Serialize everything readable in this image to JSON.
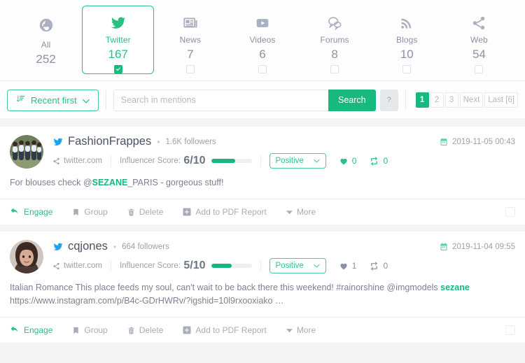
{
  "colors": {
    "accent": "#27c281",
    "accent_solid": "#18b97e",
    "muted": "#9aa1ad",
    "twitter_blue": "#1da1f2"
  },
  "tabs": [
    {
      "label": "All",
      "count": "252",
      "icon": "globe-icon",
      "active": false,
      "has_checkbox": false,
      "checked": false
    },
    {
      "label": "Twitter",
      "count": "167",
      "icon": "twitter-icon",
      "active": true,
      "has_checkbox": true,
      "checked": true
    },
    {
      "label": "News",
      "count": "7",
      "icon": "newspaper-icon",
      "active": false,
      "has_checkbox": true,
      "checked": false
    },
    {
      "label": "Videos",
      "count": "6",
      "icon": "video-icon",
      "active": false,
      "has_checkbox": true,
      "checked": false
    },
    {
      "label": "Forums",
      "count": "8",
      "icon": "forum-icon",
      "active": false,
      "has_checkbox": true,
      "checked": false
    },
    {
      "label": "Blogs",
      "count": "10",
      "icon": "rss-icon",
      "active": false,
      "has_checkbox": true,
      "checked": false
    },
    {
      "label": "Web",
      "count": "54",
      "icon": "share-icon",
      "active": false,
      "has_checkbox": true,
      "checked": false
    }
  ],
  "toolbar": {
    "sort_label": "Recent first",
    "search_placeholder": "Search in mentions",
    "search_value": "",
    "search_button": "Search",
    "help_button": "?",
    "pagination": [
      {
        "label": "1",
        "active": true
      },
      {
        "label": "2",
        "active": false
      },
      {
        "label": "3",
        "active": false
      },
      {
        "label": "Next",
        "active": false
      },
      {
        "label": "Last [6]",
        "active": false
      }
    ]
  },
  "actions": [
    {
      "label": "Engage",
      "icon": "reply-icon",
      "primary": true
    },
    {
      "label": "Group",
      "icon": "bookmark-icon",
      "primary": false
    },
    {
      "label": "Delete",
      "icon": "trash-icon",
      "primary": false
    },
    {
      "label": "Add to PDF Report",
      "icon": "plus-square-icon",
      "primary": false
    },
    {
      "label": "More",
      "icon": "caret-down-icon",
      "primary": false
    }
  ],
  "posts": [
    {
      "author": "FashionFrappes",
      "followers": "1.6K  followers",
      "source": "twitter.com",
      "score_label": "Influencer Score:",
      "score_value": "6/10",
      "score_percent": 60,
      "sentiment": "Positive",
      "likes": "0",
      "retweets": "0",
      "stats_active": true,
      "date": "2019-11-05 00:43",
      "text_before": "For blouses check @",
      "text_highlight": "SEZANE",
      "text_after": "_PARIS - gorgeous stuff!"
    },
    {
      "author": "cqjones",
      "followers": "664  followers",
      "source": "twitter.com",
      "score_label": "Influencer Score:",
      "score_value": "5/10",
      "score_percent": 50,
      "sentiment": "Positive",
      "likes": "1",
      "retweets": "0",
      "stats_active": false,
      "date": "2019-11-04 09:55",
      "text_before": "Italian Romance This place feeds my soul, can't wait to be back there this weekend! #rainorshine @imgmodels ",
      "text_highlight": "sezane",
      "text_after": " https://www.instagram.com/p/B4c-GDrHWRv/?igshid=10l9rxooxiako …"
    }
  ]
}
